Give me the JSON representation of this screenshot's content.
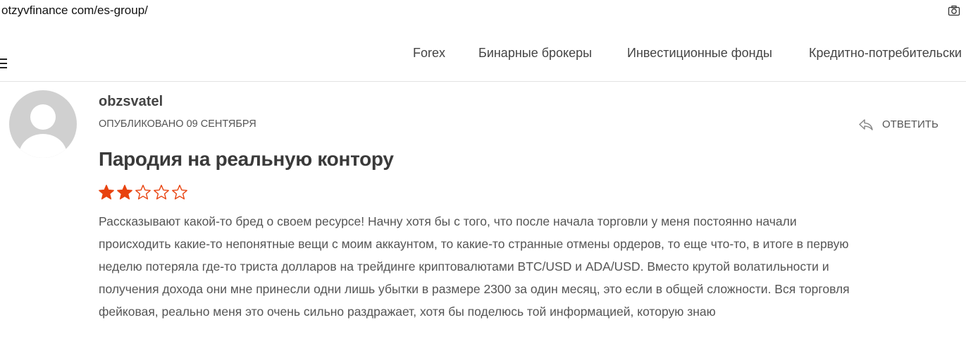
{
  "browser": {
    "url": "otzyvfinance com/es-group/"
  },
  "nav": {
    "items": [
      {
        "label": "Forex"
      },
      {
        "label": "Бинарные брокеры"
      },
      {
        "label": "Инвестиционные фонды"
      },
      {
        "label": "Кредитно-потребительски"
      }
    ]
  },
  "review": {
    "author": "obzsvatel",
    "published": "ОПУБЛИКОВАНО 09 СЕНТЯБРЯ",
    "reply_label": "ОТВЕТИТЬ",
    "title": "Пародия на реальную контору",
    "rating": 2,
    "rating_max": 5,
    "star_color": "#e8420e",
    "body_lines": [
      "Рассказывают какой-то бред о своем ресурсе! Начну хотя бы с того, что после начала торговли у меня постоянно начали",
      "происходить какие-то непонятные вещи с моим аккаунтом, то какие-то странные отмены ордеров, то еще что-то, в итоге в первую",
      "неделю потеряла где-то триста долларов на трейдинге криптовалютами BTC/USD и ADA/USD. Вместо крутой волатильности и",
      "получения дохода они мне принесли одни лишь убытки в размере 2300 за один месяц, это если в общей сложности. Вся торговля",
      "фейковая, реально меня это очень сильно раздражает, хотя бы поделюсь той информацией, которую знаю"
    ]
  },
  "icons": {
    "camera": "camera-icon",
    "menu": "hamburger-menu-icon",
    "reply": "reply-arrow-icon",
    "avatar": "default-avatar-icon"
  }
}
